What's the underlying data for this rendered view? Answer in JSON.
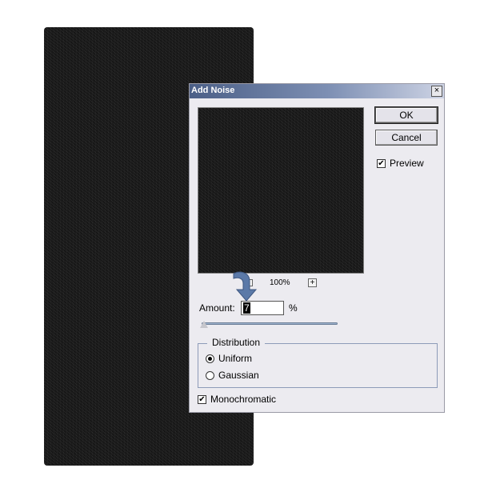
{
  "dialog": {
    "title": "Add Noise",
    "close_label": "×",
    "ok_label": "OK",
    "cancel_label": "Cancel",
    "preview": {
      "label": "Preview",
      "checked": true
    },
    "zoom": {
      "level": "100%",
      "plus": "+"
    },
    "amount": {
      "label": "Amount:",
      "value": "7",
      "unit": "%",
      "slider_fraction": 0.0175
    },
    "distribution": {
      "legend": "Distribution",
      "options": [
        {
          "label": "Uniform",
          "checked": true
        },
        {
          "label": "Gaussian",
          "checked": false
        }
      ]
    },
    "monochromatic": {
      "label": "Monochromatic",
      "checked": true
    },
    "check_mark": "✔"
  },
  "colors": {
    "noise_base": "#1b1b1b",
    "title_gradient_start": "#4b5f87",
    "title_gradient_end": "#cdd3e4",
    "dialog_bg": "#ecebf0",
    "arrow": "#5b79a8"
  },
  "icons": {
    "zoom_out": "minus-icon",
    "zoom_in": "plus-icon",
    "pointer": "curved-arrow-icon"
  }
}
